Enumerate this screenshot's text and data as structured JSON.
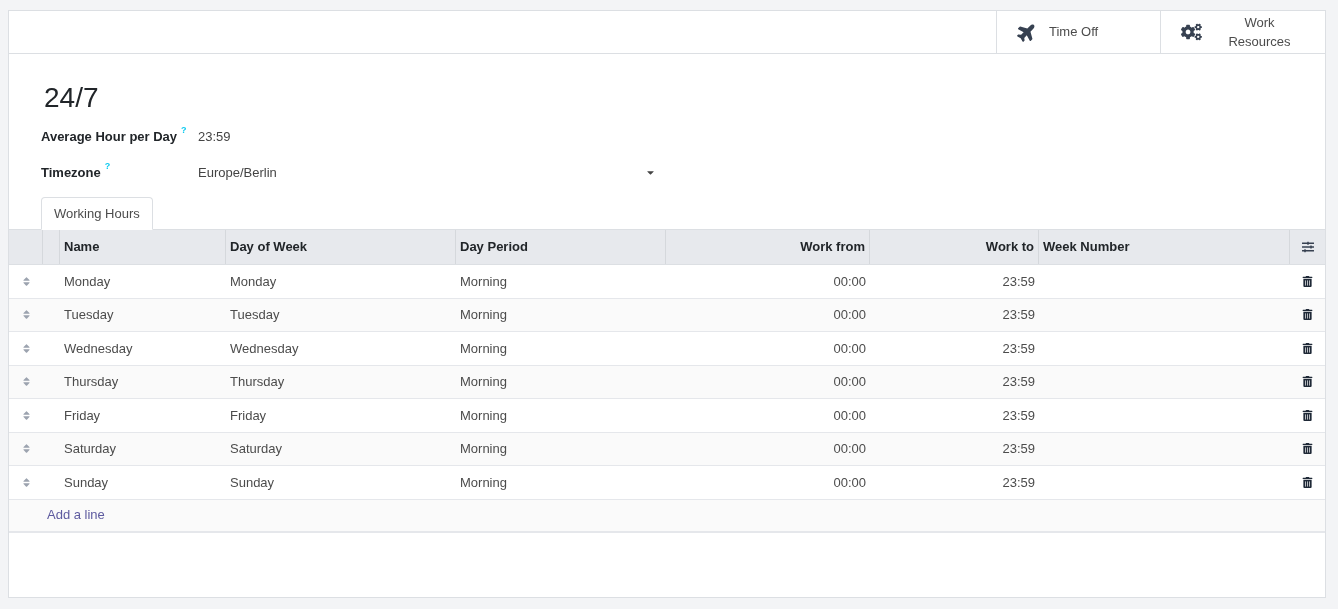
{
  "header_buttons": [
    {
      "kind": "plane",
      "label": "Time Off"
    },
    {
      "kind": "gears",
      "label": "Work Resources"
    }
  ],
  "title": "24/7",
  "fields": [
    {
      "label": "Average Hour per Day",
      "help": "?",
      "value": "23:59",
      "kind": "text"
    },
    {
      "label": "Timezone",
      "help": "?",
      "value": "Europe/Berlin",
      "kind": "select"
    }
  ],
  "tabs": [
    {
      "label": "Working Hours",
      "selected": true
    }
  ],
  "table": {
    "columns": [
      "Name",
      "Day of Week",
      "Day Period",
      "Work from",
      "Work to",
      "Week Number"
    ],
    "rows": [
      [
        "Monday",
        "Monday",
        "Morning",
        "00:00",
        "23:59"
      ],
      [
        "Tuesday",
        "Tuesday",
        "Morning",
        "00:00",
        "23:59"
      ],
      [
        "Wednesday",
        "Wednesday",
        "Morning",
        "00:00",
        "23:59"
      ],
      [
        "Thursday",
        "Thursday",
        "Morning",
        "00:00",
        "23:59"
      ],
      [
        "Friday",
        "Friday",
        "Morning",
        "00:00",
        "23:59"
      ],
      [
        "Saturday",
        "Saturday",
        "Morning",
        "00:00",
        "23:59"
      ],
      [
        "Sunday",
        "Sunday",
        "Morning",
        "00:00",
        "23:59"
      ]
    ],
    "add_line": "Add a line"
  }
}
